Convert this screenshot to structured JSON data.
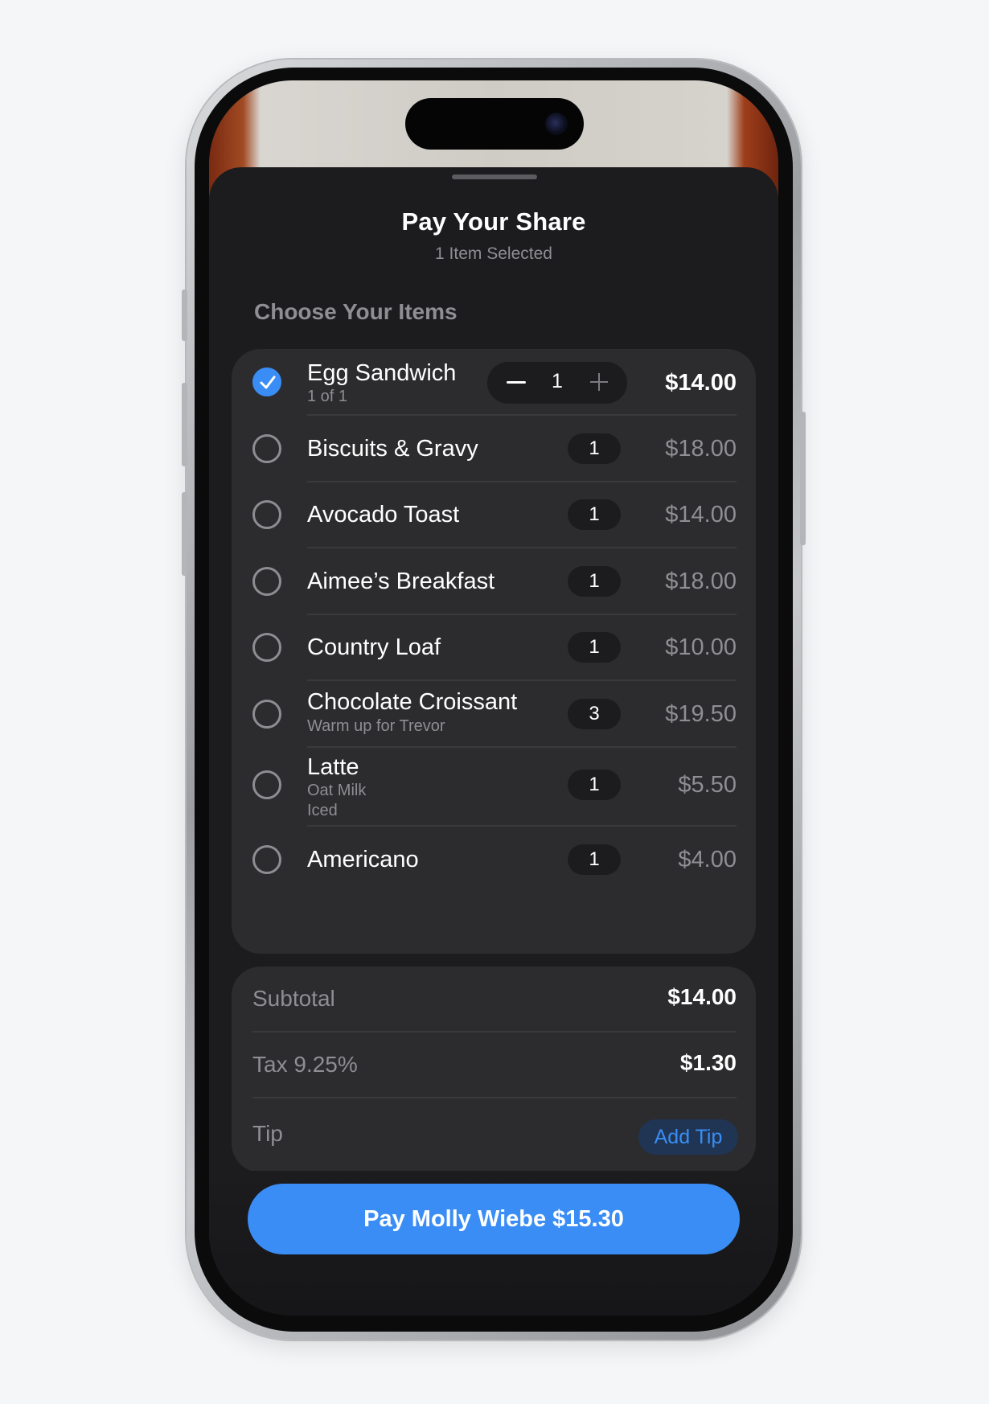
{
  "sheet": {
    "title": "Pay Your Share",
    "subtitle": "1 Item Selected"
  },
  "items_section": {
    "header": "Choose Your Items",
    "items": [
      {
        "name": "Egg Sandwich",
        "note": "1 of 1",
        "qty": "1",
        "price": "$14.00",
        "selected": true
      },
      {
        "name": "Biscuits & Gravy",
        "note": "",
        "qty": "1",
        "price": "$18.00",
        "selected": false
      },
      {
        "name": "Avocado Toast",
        "note": "",
        "qty": "1",
        "price": "$14.00",
        "selected": false
      },
      {
        "name": "Aimee’s Breakfast",
        "note": "",
        "qty": "1",
        "price": "$18.00",
        "selected": false
      },
      {
        "name": "Country Loaf",
        "note": "",
        "qty": "1",
        "price": "$10.00",
        "selected": false
      },
      {
        "name": "Chocolate Croissant",
        "note": "Warm up for Trevor",
        "qty": "3",
        "price": "$19.50",
        "selected": false
      },
      {
        "name": "Latte",
        "notes": [
          "Oat Milk",
          "Iced"
        ],
        "qty": "1",
        "price": "$5.50",
        "selected": false
      },
      {
        "name": "Americano",
        "note": "",
        "qty": "1",
        "price": "$4.00",
        "selected": false
      }
    ]
  },
  "summary": {
    "subtotal_label": "Subtotal",
    "subtotal_value": "$14.00",
    "tax_label": "Tax 9.25%",
    "tax_value": "$1.30",
    "tip_label": "Tip",
    "add_tip_label": "Add Tip"
  },
  "pay_button": {
    "label": "Pay Molly Wiebe $15.30"
  },
  "colors": {
    "accent": "#3a8df5",
    "sheet_background": "#1c1c1e",
    "card_background": "#2c2c2e",
    "secondary_text": "#8e8e93"
  },
  "icons": {
    "checkmark": "checkmark-icon",
    "minus": "minus-icon",
    "plus": "plus-icon"
  }
}
